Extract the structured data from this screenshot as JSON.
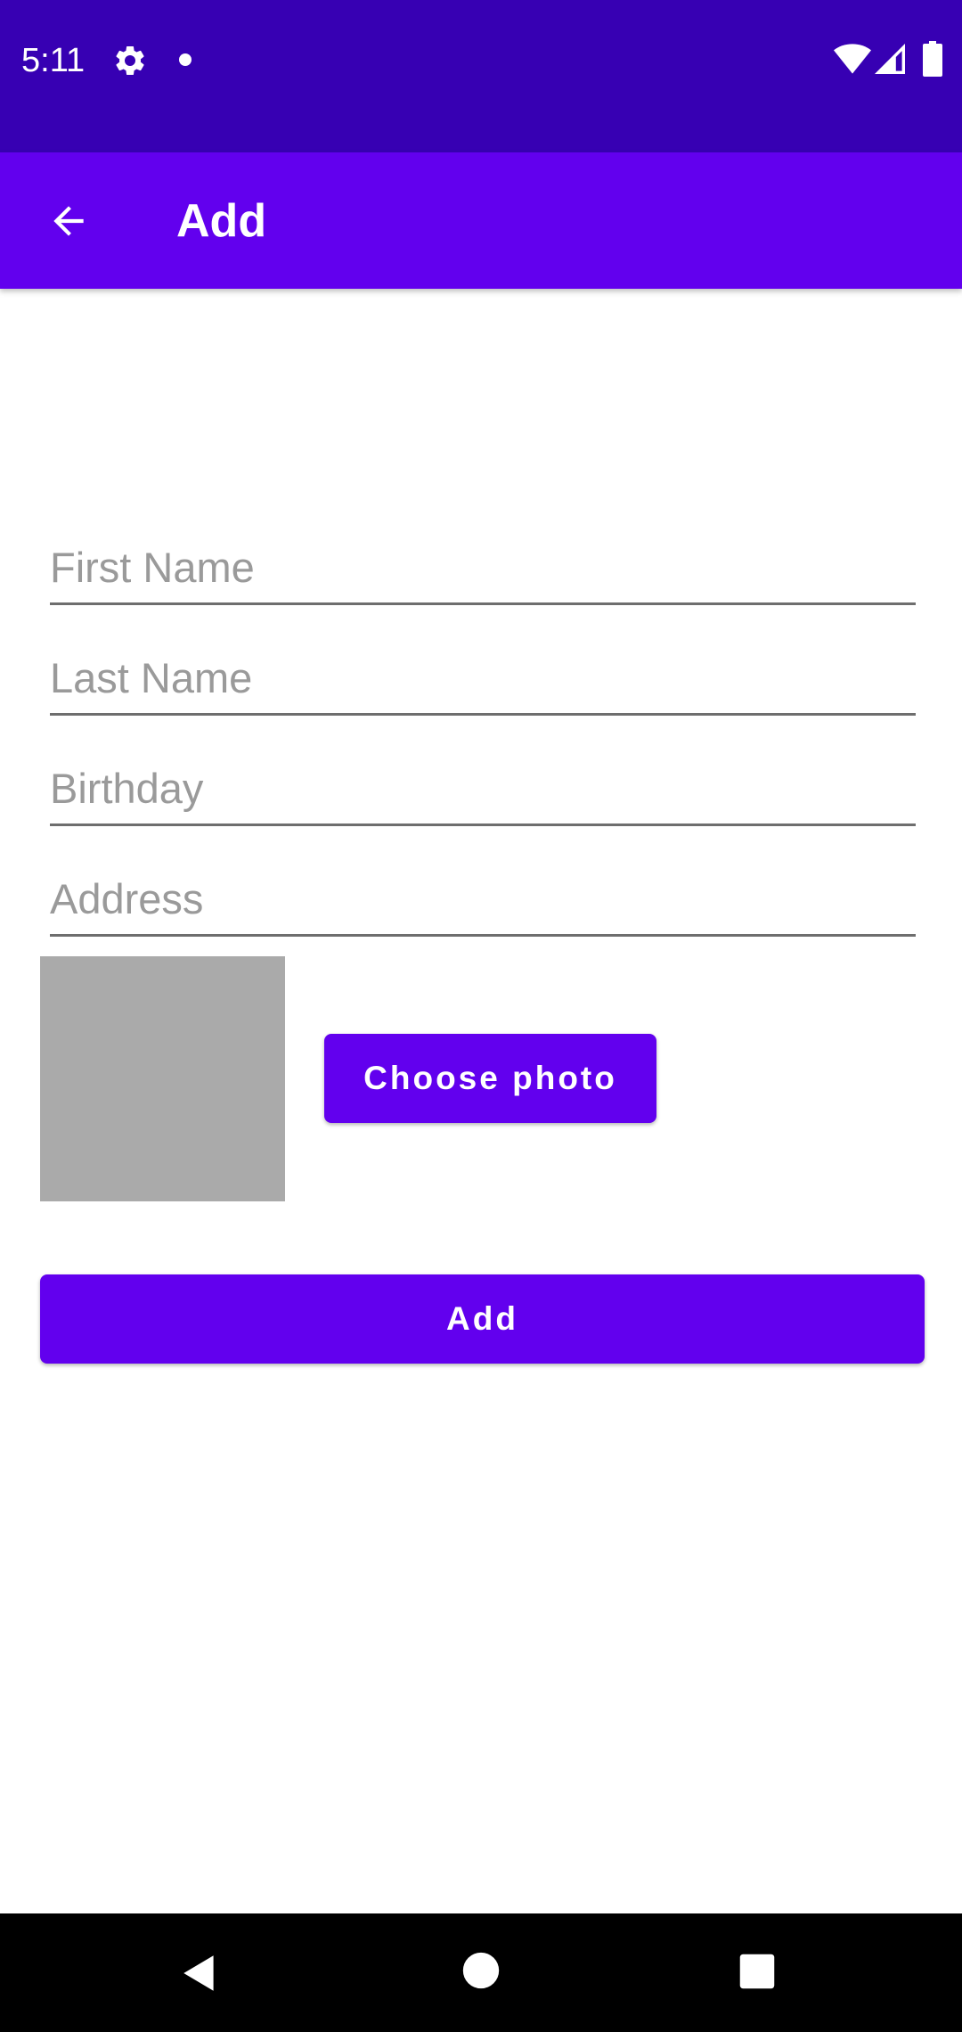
{
  "status_bar": {
    "time": "5:11",
    "icons": [
      "gear-icon",
      "notification-dot-icon",
      "wifi-icon",
      "signal-icon",
      "battery-icon"
    ]
  },
  "app_bar": {
    "title": "Add",
    "back_icon": "arrow-back-icon"
  },
  "form": {
    "first_name": {
      "value": "",
      "placeholder": "First Name"
    },
    "last_name": {
      "value": "",
      "placeholder": "Last Name"
    },
    "birthday": {
      "value": "",
      "placeholder": "Birthday"
    },
    "address": {
      "value": "",
      "placeholder": "Address"
    }
  },
  "photo": {
    "choose_label": "Choose photo"
  },
  "actions": {
    "add_label": "Add"
  },
  "nav_bar": {
    "icons": [
      "nav-back-icon",
      "nav-home-icon",
      "nav-recents-icon"
    ]
  },
  "colors": {
    "status_bar": "#3700b3",
    "primary": "#6200ee",
    "photo_placeholder": "#aaaaaa",
    "underline": "#6e6e6e",
    "hint_text": "#9a9a9a",
    "nav_bar": "#000000"
  }
}
